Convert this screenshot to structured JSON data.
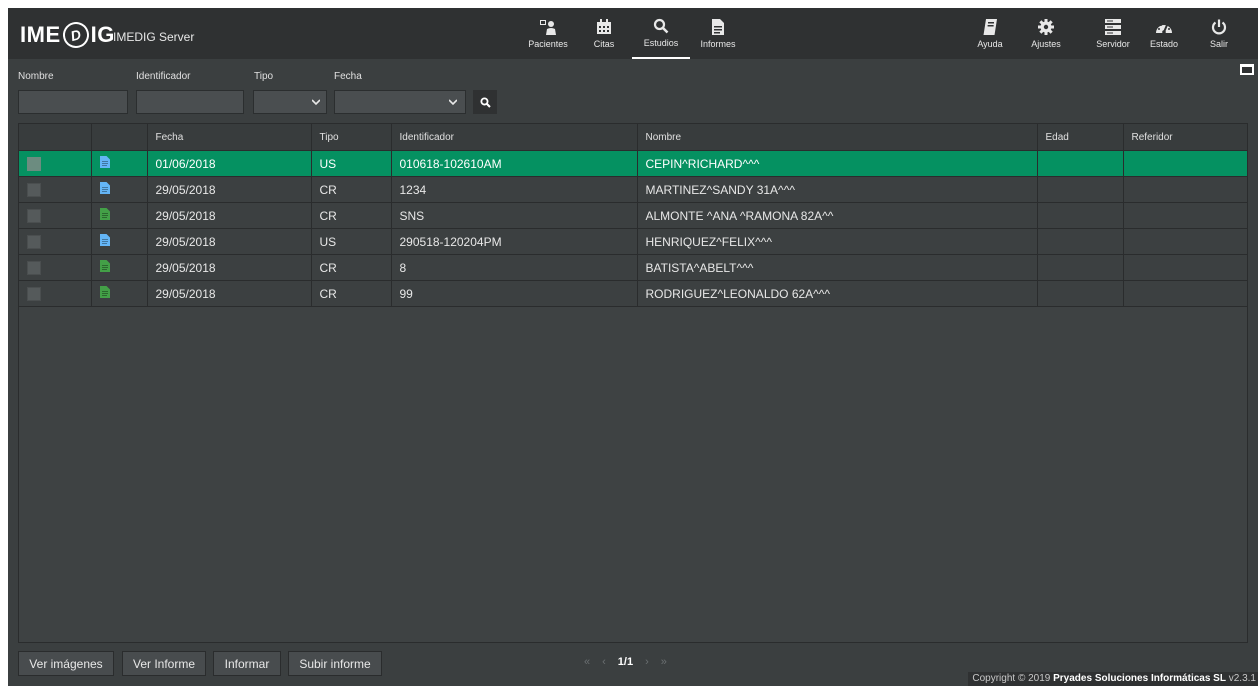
{
  "app": {
    "logo_text_left": "IME",
    "logo_glyph": "D",
    "logo_text_right": "IG",
    "server_name": "IMEDIG Server"
  },
  "nav_center": [
    {
      "label": "Pacientes",
      "icon": "patients-icon"
    },
    {
      "label": "Citas",
      "icon": "calendar-icon"
    },
    {
      "label": "Estudios",
      "icon": "search-icon",
      "active": true
    },
    {
      "label": "Informes",
      "icon": "document-icon"
    }
  ],
  "nav_right": [
    {
      "label": "Ayuda",
      "icon": "book-icon"
    },
    {
      "label": "Ajustes",
      "icon": "gear-icon"
    },
    {
      "label": "Servidor",
      "icon": "server-icon"
    },
    {
      "label": "Estado",
      "icon": "dashboard-icon"
    },
    {
      "label": "Salir",
      "icon": "power-icon"
    }
  ],
  "filters": {
    "nombre_label": "Nombre",
    "identificador_label": "Identificador",
    "tipo_label": "Tipo",
    "fecha_label": "Fecha",
    "nombre_value": "",
    "identificador_value": "",
    "tipo_value": "",
    "fecha_value": ""
  },
  "table": {
    "columns": [
      "",
      "",
      "Fecha",
      "Tipo",
      "Identificador",
      "Nombre",
      "Edad",
      "Referidor"
    ],
    "rows": [
      {
        "fecha": "01/06/2018",
        "tipo": "US",
        "identificador": "010618-102610AM",
        "nombre": "CEPIN^RICHARD^^^",
        "edad": "",
        "referidor": "",
        "doc_color": "blue",
        "selected": true
      },
      {
        "fecha": "29/05/2018",
        "tipo": "CR",
        "identificador": "1234",
        "nombre": "MARTINEZ^SANDY 31A^^^",
        "edad": "",
        "referidor": "",
        "doc_color": "blue",
        "selected": false
      },
      {
        "fecha": "29/05/2018",
        "tipo": "CR",
        "identificador": "SNS",
        "nombre": "ALMONTE ^ANA ^RAMONA 82A^^",
        "edad": "",
        "referidor": "",
        "doc_color": "green",
        "selected": false
      },
      {
        "fecha": "29/05/2018",
        "tipo": "US",
        "identificador": "290518-120204PM",
        "nombre": "HENRIQUEZ^FELIX^^^",
        "edad": "",
        "referidor": "",
        "doc_color": "blue",
        "selected": false
      },
      {
        "fecha": "29/05/2018",
        "tipo": "CR",
        "identificador": "8",
        "nombre": "BATISTA^ABELT^^^",
        "edad": "",
        "referidor": "",
        "doc_color": "green",
        "selected": false
      },
      {
        "fecha": "29/05/2018",
        "tipo": "CR",
        "identificador": "99",
        "nombre": "RODRIGUEZ^LEONALDO 62A^^^",
        "edad": "",
        "referidor": "",
        "doc_color": "green",
        "selected": false
      }
    ]
  },
  "buttons": {
    "ver_imagenes": "Ver imágenes",
    "ver_informe": "Ver Informe",
    "informar": "Informar",
    "subir_informe": "Subir informe"
  },
  "pager": {
    "first": "«",
    "prev": "‹",
    "current": "1/1",
    "next": "›",
    "last": "»"
  },
  "footer": {
    "copyright_prefix": "Copyright © 2019",
    "company": "Pryades Soluciones Informáticas SL",
    "version": "v2.3.1"
  },
  "colors": {
    "topbar": "#2f3132",
    "background": "#3b3f40",
    "selected_row": "#059161",
    "doc_blue": "#64b5f6",
    "doc_green": "#43a047"
  }
}
